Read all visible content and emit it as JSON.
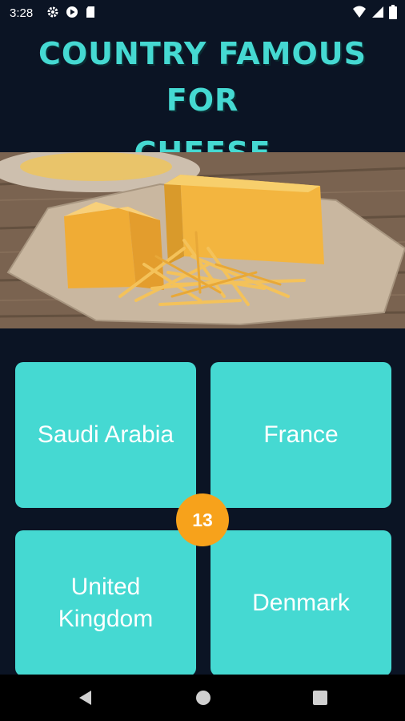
{
  "status": {
    "time": "3:28",
    "icons": [
      "gear-icon",
      "play-protect-icon",
      "sd-card-icon",
      "wifi-icon",
      "signal-icon",
      "battery-icon"
    ]
  },
  "quiz": {
    "title_line1": "COUNTRY FAMOUS FOR",
    "title_line2": "CHEESE",
    "image": "cheddar-cheese-photo",
    "counter": "13",
    "answers": {
      "a": "Saudi Arabia",
      "b": "France",
      "c": "United Kingdom",
      "d": "Denmark"
    }
  },
  "colors": {
    "background": "#0b1424",
    "answer_tile": "#45d9d2",
    "title": "#45d9d2",
    "counter_badge": "#f7a21b"
  },
  "nav": {
    "icons": [
      "back-icon",
      "home-icon",
      "recents-icon"
    ]
  }
}
